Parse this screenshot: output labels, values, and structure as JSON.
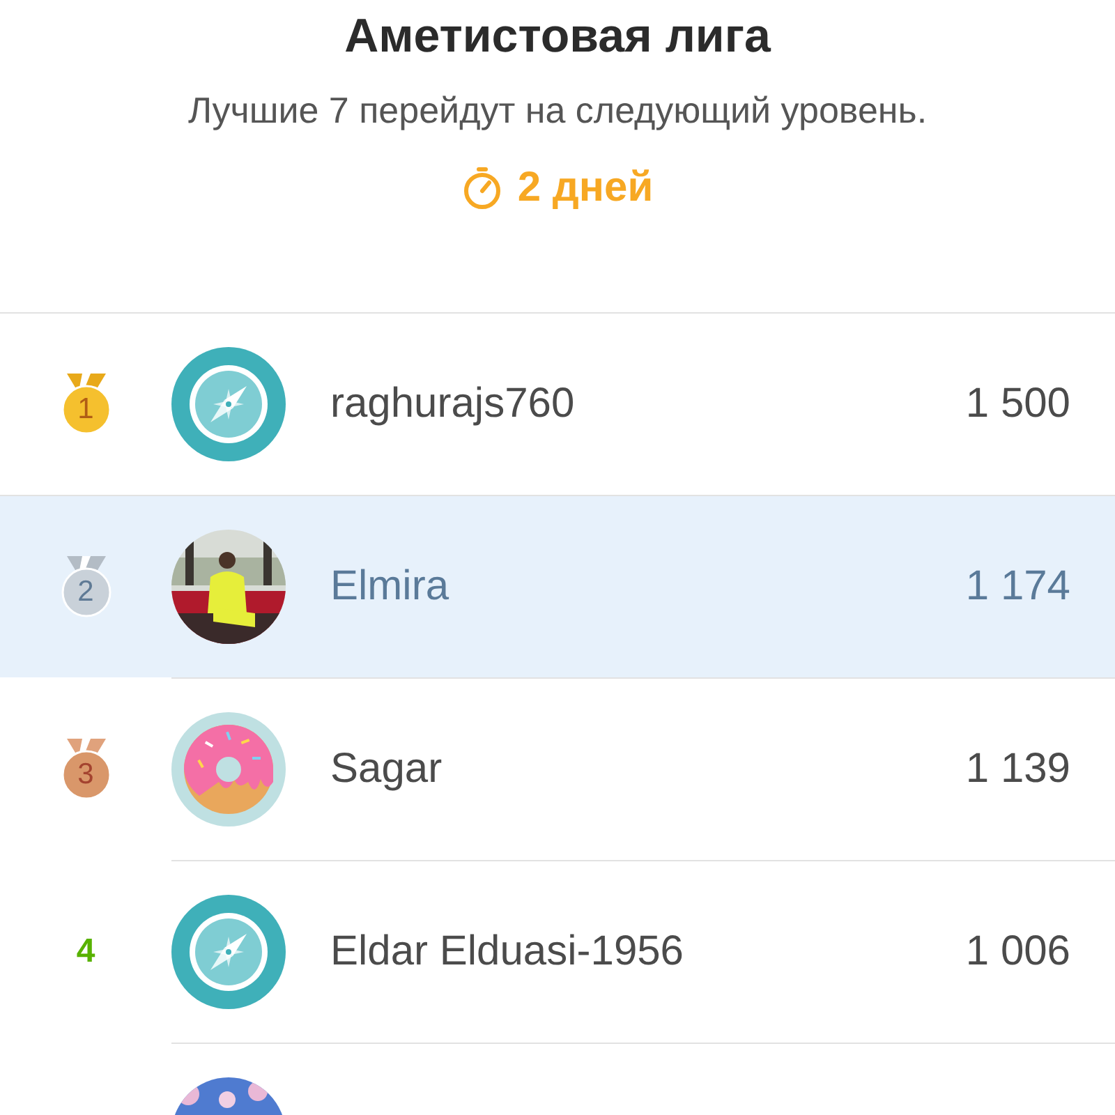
{
  "header": {
    "title": "Аметистовая лига",
    "subtitle": "Лучшие 7 перейдут на следующий уровень.",
    "timer": "2 дней"
  },
  "rows": [
    {
      "badge": {
        "kind": "gold",
        "rank": "1"
      },
      "avatar": {
        "kind": "compass"
      },
      "name": "raghurajs760",
      "score": "1 500",
      "selected": false
    },
    {
      "badge": {
        "kind": "silver",
        "rank": "2"
      },
      "name": "Elmira",
      "score": "1 174",
      "selected": true
    },
    {
      "badge": {
        "kind": "bronze",
        "rank": "3"
      },
      "avatar": {
        "kind": "donut"
      },
      "name": "Sagar",
      "score": "1 139",
      "selected": false
    },
    {
      "badge": {
        "kind": "plain",
        "rank": "4"
      },
      "avatar": {
        "kind": "compass"
      },
      "name": "Eldar Elduasi-1956",
      "score": "1 006",
      "selected": false
    },
    {
      "selected": false
    }
  ]
}
